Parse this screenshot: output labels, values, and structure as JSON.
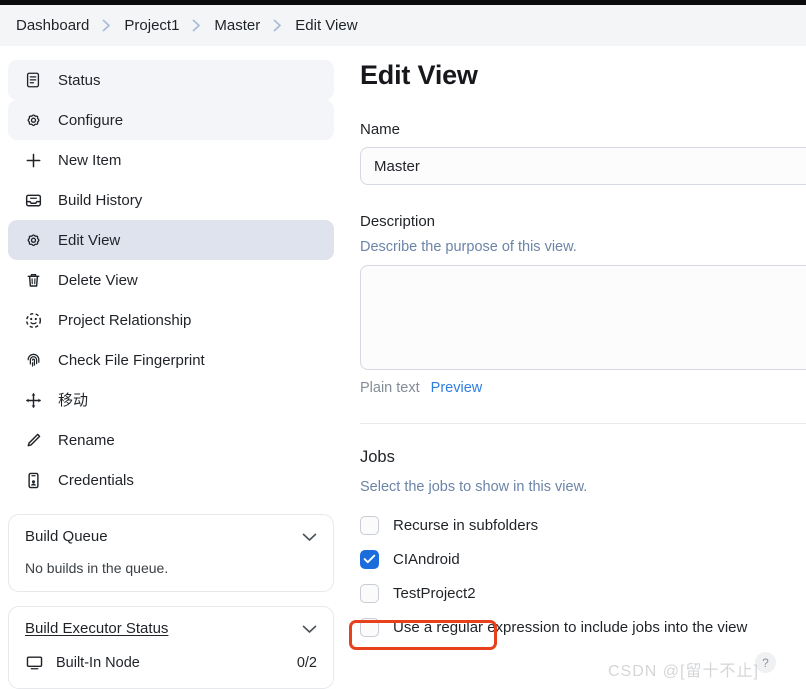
{
  "breadcrumb": {
    "items": [
      {
        "label": "Dashboard"
      },
      {
        "label": "Project1"
      },
      {
        "label": "Master"
      },
      {
        "label": "Edit View"
      }
    ]
  },
  "sidebar": {
    "items": [
      {
        "label": "Status",
        "icon": "document-icon",
        "state": "shade"
      },
      {
        "label": "Configure",
        "icon": "gear-icon",
        "state": "shade"
      },
      {
        "label": "New Item",
        "icon": "plus-icon",
        "state": "normal"
      },
      {
        "label": "Build History",
        "icon": "inbox-icon",
        "state": "normal"
      },
      {
        "label": "Edit View",
        "icon": "gear-icon",
        "state": "active"
      },
      {
        "label": "Delete View",
        "icon": "trash-icon",
        "state": "normal"
      },
      {
        "label": "Project Relationship",
        "icon": "relationship-icon",
        "state": "normal"
      },
      {
        "label": "Check File Fingerprint",
        "icon": "fingerprint-icon",
        "state": "normal"
      },
      {
        "label": "移动",
        "icon": "move-icon",
        "state": "normal"
      },
      {
        "label": "Rename",
        "icon": "pencil-icon",
        "state": "normal"
      },
      {
        "label": "Credentials",
        "icon": "credentials-icon",
        "state": "normal"
      }
    ],
    "build_queue": {
      "title": "Build Queue",
      "empty_text": "No builds in the queue.",
      "chevron": "chevron-down-icon"
    },
    "build_executor_status": {
      "title": "Build Executor Status",
      "chevron": "chevron-down-icon",
      "rows": [
        {
          "label": "Built-In Node",
          "count": "0/2"
        }
      ]
    }
  },
  "main": {
    "page_title": "Edit View",
    "name": {
      "label": "Name",
      "value": "Master",
      "placeholder": ""
    },
    "description": {
      "label": "Description",
      "help": "Describe the purpose of this view.",
      "value": "",
      "placeholder": "",
      "plain_text_label": "Plain text",
      "preview_label": "Preview"
    },
    "jobs": {
      "title": "Jobs",
      "help": "Select the jobs to show in this view.",
      "checkboxes": [
        {
          "label": "Recurse in subfolders",
          "checked": false,
          "highlighted": false
        },
        {
          "label": "CIAndroid",
          "checked": true,
          "highlighted": false
        },
        {
          "label": "TestProject2",
          "checked": false,
          "highlighted": true
        },
        {
          "label": "Use a regular expression to include jobs into the view",
          "checked": false,
          "highlighted": false
        }
      ],
      "help_icon": "question-mark-icon"
    }
  },
  "annotation": {
    "color": "#e8401c",
    "target": "TestProject2"
  },
  "watermark": {
    "text": "CSDN @[留十不止]"
  },
  "colors": {
    "accent_blue": "#1b6ddb",
    "link_blue": "#2f7fe0",
    "help_text": "#6b84a8",
    "active_nav": "#dee3ee",
    "annotation_red": "#e8401c"
  }
}
